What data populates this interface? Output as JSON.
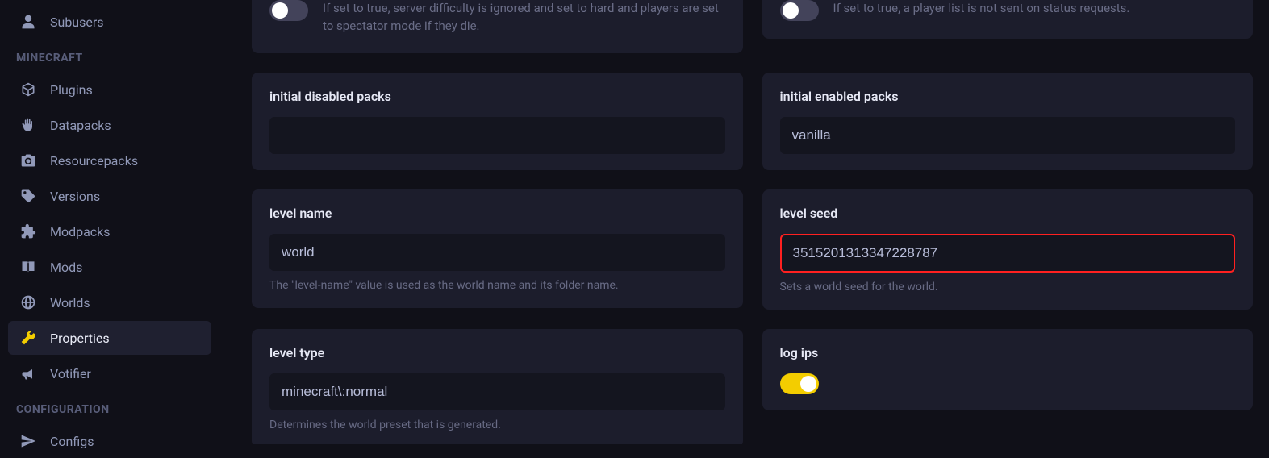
{
  "sidebar": {
    "items": [
      {
        "label": "Subusers"
      }
    ],
    "section_minecraft": "MINECRAFT",
    "mc_items": [
      {
        "label": "Plugins"
      },
      {
        "label": "Datapacks"
      },
      {
        "label": "Resourcepacks"
      },
      {
        "label": "Versions"
      },
      {
        "label": "Modpacks"
      },
      {
        "label": "Mods"
      },
      {
        "label": "Worlds"
      },
      {
        "label": "Properties"
      },
      {
        "label": "Votifier"
      }
    ],
    "section_config": "CONFIGURATION",
    "conf_items": [
      {
        "label": "Configs"
      }
    ]
  },
  "top_left": {
    "toggle": false,
    "help": "If set to true, server difficulty is ignored and set to hard and players are set to spectator mode if they die."
  },
  "top_right": {
    "toggle": false,
    "help": "If set to true, a player list is not sent on status requests."
  },
  "cards": {
    "initial_disabled_packs": {
      "label": "initial disabled packs",
      "value": ""
    },
    "initial_enabled_packs": {
      "label": "initial enabled packs",
      "value": "vanilla"
    },
    "level_name": {
      "label": "level name",
      "value": "world",
      "help": "The \"level-name\" value is used as the world name and its folder name."
    },
    "level_seed": {
      "label": "level seed",
      "value": "3515201313347228787",
      "help": "Sets a world seed for the world."
    },
    "level_type": {
      "label": "level type",
      "value": "minecraft\\:normal",
      "help": "Determines the world preset that is generated."
    },
    "log_ips": {
      "label": "log ips",
      "toggle": true
    }
  }
}
